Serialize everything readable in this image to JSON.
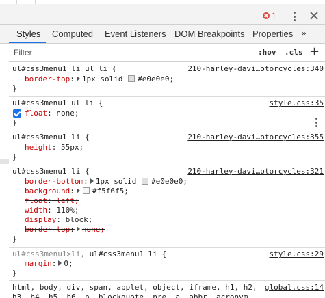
{
  "topbar": {
    "error_count": "1",
    "error_icon": "error-icon",
    "menu_icon": "kebab-icon",
    "close_icon": "close-icon",
    "error_color": "#d93025"
  },
  "tabs": [
    {
      "label": "Styles",
      "active": true
    },
    {
      "label": "Computed",
      "active": false
    },
    {
      "label": "Event Listeners",
      "active": false
    },
    {
      "label": "DOM Breakpoints",
      "active": false
    },
    {
      "label": "Properties",
      "active": false
    }
  ],
  "tabs_more": "»",
  "accent": "#1a73e8",
  "filter": {
    "placeholder": "Filter",
    "value": "",
    "hov": ":hov",
    "cls": ".cls",
    "add": "+"
  },
  "rules": [
    {
      "selector": "ul#css3menu1 li ul li {",
      "source": "210-harley-davi…otorcycles:340",
      "decls": [
        {
          "prop": "border-top",
          "sep": ":",
          "tri": true,
          "value_pre": "1px solid ",
          "swatch": "#e0e0e0",
          "value": "#e0e0e0;"
        }
      ],
      "close": "}"
    },
    {
      "selector": "ul#css3menu1 ul li {",
      "source": "style.css:35",
      "decls": [
        {
          "prop": "float",
          "sep": ":",
          "value": " none;",
          "checked": true
        }
      ],
      "close": "}"
    },
    {
      "selector": "ul#css3menu1 li {",
      "source": "210-harley-davi…otorcycles:355",
      "decls": [
        {
          "prop": "height",
          "sep": ":",
          "value": " 55px;"
        }
      ],
      "close": "}"
    },
    {
      "selector": "ul#css3menu1 li {",
      "source": "210-harley-davi…otorcycles:321",
      "decls": [
        {
          "prop": "border-bottom",
          "sep": ":",
          "tri": true,
          "value_pre": "1px solid ",
          "swatch": "#e0e0e0",
          "value": "#e0e0e0;"
        },
        {
          "prop": "background",
          "sep": ":",
          "tri": true,
          "value_pre": "",
          "swatch": "#f5f6f5",
          "value": "#f5f6f5;"
        },
        {
          "prop": "float",
          "sep": ":",
          "value": " left;",
          "struck": true
        },
        {
          "prop": "width",
          "sep": ":",
          "value": " 110%;"
        },
        {
          "prop": "display",
          "sep": ":",
          "value": " block;"
        },
        {
          "prop": "border-top",
          "sep": ":",
          "tri": true,
          "value": "none;",
          "struck": true
        }
      ],
      "close": "}"
    },
    {
      "selector_dim": "ul#css3menu1>li, ",
      "selector": "ul#css3menu1 li {",
      "source": "style.css:29",
      "decls": [
        {
          "prop": "margin",
          "sep": ":",
          "tri": true,
          "value": "0;"
        }
      ],
      "close": "}"
    }
  ],
  "global_rule": {
    "line1": "html, body, div, span, applet, object, iframe, h1, h2,",
    "line2": "h3, h4, h5, h6, p, blockquote, pre, a, abbr, acronym,",
    "source": "global.css:14"
  }
}
